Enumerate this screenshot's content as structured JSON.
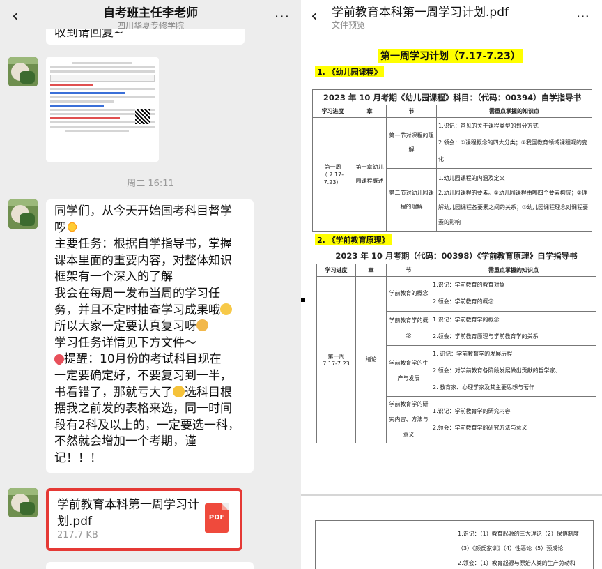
{
  "chat": {
    "title": "自考班主任李老师",
    "subtitle": "四川华夏专修学院",
    "back_icon": "‹",
    "more_icon": "···",
    "cut_text": "收到请回复~",
    "timestamp": "周二 16:11",
    "message_lines": [
      "同学们，从今天开始国考科目督学",
      "啰",
      "主要任务：根据自学指导书，掌握",
      "课本里面的重要内容，对整体知识",
      "框架有一个深入的了解",
      "我会在每周一发布当周的学习任",
      "务，并且不定时抽查学习成果哦",
      "所以大家一定要认真复习呀",
      "学习任务详情见下方文件～",
      "提醒：10月份的考试科目现在",
      "一定要确定好，不要复习到一半，",
      "书看错了，那就亏大了",
      "选科目根",
      "据我之前发的表格来选，同一时间",
      "段有2科及以上的，一定要选一科，",
      "不然就会增加一个考期，谨",
      "记！！！"
    ],
    "file": {
      "name": "学前教育本科第一周学习计划.pdf",
      "size": "217.7 KB",
      "type_label": "PDF"
    }
  },
  "preview": {
    "title": "学前教育本科第一周学习计划.pdf",
    "subtitle": "文件预览",
    "back_icon": "‹",
    "more_icon": "···",
    "doc_title": "第一周学习计划（7.17-7.23）",
    "section1": {
      "heading": "1. 《幼儿园课程》",
      "caption": "2023 年 10 月考期《幼儿园课程》科目：（代码：00394）自学指导书",
      "headers": [
        "学习进度",
        "章",
        "节",
        "需重点掌握的知识点"
      ],
      "week": "第一周",
      "dates": "（ 7.17-7.23）",
      "chapter": "第一章幼儿园课程概述",
      "rows": [
        {
          "section": "第一节对课程的理解",
          "points": [
            "1.识记：常见的关于课程类型的划分方式",
            "2.领会：①课程概念的四大分类；②我国教育领域课程观的变化"
          ]
        },
        {
          "section": "第二节对幼儿园课程的理解",
          "points": [
            "1.幼儿园课程的内涵及定义",
            "2.幼儿园课程的要素。①幼儿园课程由哪四个要素构成；②理解幼儿园课程各要素之间的关系；③幼儿园课程理念对课程要素的影响"
          ]
        }
      ]
    },
    "section2": {
      "heading": "2. 《学前教育原理》",
      "caption": "2023 年 10 月考期（代码：00398）《学前教育原理》自学指导书",
      "headers": [
        "学习进度",
        "章",
        "节",
        "需重点掌握的知识点"
      ],
      "week": "第一周",
      "dates": "7.17-7.23",
      "chapter": "绪论",
      "rows": [
        {
          "section": "学前教育的概念",
          "points": [
            "1.识记：学前教育的教育对象",
            "2.领会：学前教育的概念"
          ]
        },
        {
          "section": "学前教育学的概念",
          "points": [
            "1.识记：学前教育学的概念",
            "2.领会：学前教育原理与学前教育学的关系"
          ]
        },
        {
          "section": "学前教育学的生产与发展",
          "points": [
            "1. 识记：学前教育学的发展历程",
            "2.领会：对学前教育各阶段发展做出贡献的哲学家、",
            "2. 教育家、心理学家及其主要思想与著作"
          ]
        },
        {
          "section": "学前教育学的研究内容、方法与意义",
          "points": [
            "1.识记：学前教育学的研究内容",
            "2.领会：学前教育学的研究方法与意义"
          ]
        }
      ]
    },
    "page2_lines": [
      "1.识记：（1）教育起源的三大理论（2）保傅制度",
      "（3）《颜氏家训》（4）性恶论（5）预成论",
      "2.领会：（1）教育起源与原始人类的生产劳动和"
    ]
  }
}
